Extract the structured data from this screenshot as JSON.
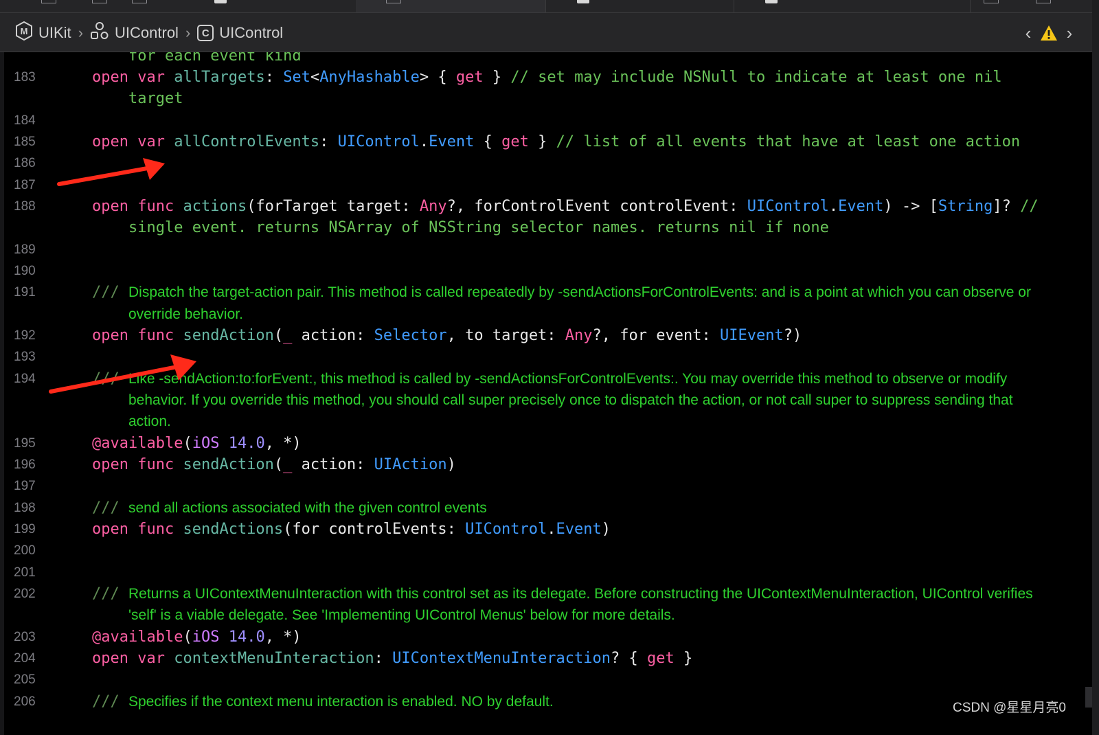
{
  "jumpbar": {
    "crumbs": [
      {
        "badge": "M",
        "label": "UIKit"
      },
      {
        "badge": "",
        "label": "UIControl"
      },
      {
        "badge": "C",
        "label": "UIControl"
      }
    ],
    "separator": "›",
    "nav_back": "‹",
    "nav_forward": "›"
  },
  "editor": {
    "lines": {
      "partial_top": "for each event kind",
      "l183_num": "183",
      "l183": {
        "open": "open",
        "var": "var",
        "name": "allTargets",
        "colon": ": ",
        "set": "Set",
        "lt": "<",
        "ah": "AnyHashable",
        "gt": ">",
        "lb": " { ",
        "get": "get",
        "rb": " } ",
        "comment": "// set may include NSNull to indicate at least one nil",
        "comment2": "target"
      },
      "l184_num": "184",
      "l185_num": "185",
      "l185": {
        "open": "open",
        "var": "var",
        "name": "allControlEvents",
        "colon": ": ",
        "t1": "UIControl",
        "dot": ".",
        "t2": "Event",
        "lb": " { ",
        "get": "get",
        "rb": " } ",
        "comment": "// list of all events that have at least one action"
      },
      "l186_num": "186",
      "l187_num": "187",
      "l188_num": "188",
      "l188": {
        "open": "open",
        "func": "func",
        "name": "actions",
        "p1": "(forTarget target: ",
        "any": "Any",
        "p2": "?, forControlEvent controlEvent: ",
        "t1": "UIControl",
        "dot": ".",
        "t2": "Event",
        "p3": ") -> [",
        "str": "String",
        "p4": "]? ",
        "comment": "//",
        "comment2": "single event. returns NSArray of NSString selector names. returns nil if none"
      },
      "l189_num": "189",
      "l190_num": "190",
      "l191_num": "191",
      "l191": {
        "mark": "///",
        "doc": "Dispatch the target-action pair. This method is called repeatedly by -sendActionsForControlEvents: and is a point at which you can observe or",
        "doc2": "override behavior."
      },
      "l192_num": "192",
      "l192": {
        "open": "open",
        "func": "func",
        "name": "sendAction",
        "p1": "(",
        "us": "_",
        "p2": " action: ",
        "sel": "Selector",
        "p3": ", to target: ",
        "any": "Any",
        "p4": "?, for event: ",
        "ev": "UIEvent",
        "p5": "?)"
      },
      "l193_num": "193",
      "l194_num": "194",
      "l194": {
        "mark": "///",
        "doc": "Like -sendAction:to:forEvent:, this method is called by -sendActionsForControlEvents:. You may override this method to observe or modify",
        "doc2": "behavior. If you override this method, you should call super precisely once to dispatch the action, or not call super to suppress sending that",
        "doc3": "action."
      },
      "l195_num": "195",
      "l195": {
        "at": "@available",
        "p1": "(",
        "ios": "iOS",
        "sp": " ",
        "ver": "14.0",
        "p2": ", *)"
      },
      "l196_num": "196",
      "l196": {
        "open": "open",
        "func": "func",
        "name": "sendAction",
        "p1": "(",
        "us": "_",
        "p2": " action: ",
        "t": "UIAction",
        "p3": ")"
      },
      "l197_num": "197",
      "l198_num": "198",
      "l198": {
        "mark": "///",
        "doc": "send all actions associated with the given control events"
      },
      "l199_num": "199",
      "l199": {
        "open": "open",
        "func": "func",
        "name": "sendActions",
        "p1": "(for controlEvents: ",
        "t1": "UIControl",
        "dot": ".",
        "t2": "Event",
        "p2": ")"
      },
      "l200_num": "200",
      "l201_num": "201",
      "l202_num": "202",
      "l202": {
        "mark": "///",
        "doc": "Returns a UIContextMenuInteraction with this control set as its delegate. Before constructing the UIContextMenuInteraction, UIControl verifies",
        "doc2": "'self' is a viable delegate. See 'Implementing UIControl Menus' below for more details."
      },
      "l203_num": "203",
      "l203": {
        "at": "@available",
        "p1": "(",
        "ios": "iOS",
        "sp": " ",
        "ver": "14.0",
        "p2": ", *)"
      },
      "l204_num": "204",
      "l204": {
        "open": "open",
        "var": "var",
        "name": "contextMenuInteraction",
        "colon": ": ",
        "t": "UIContextMenuInteraction",
        "q": "? { ",
        "get": "get",
        "rb": " }"
      },
      "l205_num": "205",
      "l206_num": "206",
      "l206": {
        "mark": "///",
        "doc": "Specifies if the context menu interaction is enabled. NO by default."
      }
    }
  },
  "watermark": "CSDN @星星月亮0",
  "colors": {
    "keyword": "#fc5fa3",
    "type": "#419cff",
    "doc_comment": "#2fd12f",
    "line_comment": "#6ac259",
    "annotation_arrow": "#ff2a1a"
  },
  "icons": [
    "module-icon",
    "folder-group-icon",
    "class-icon",
    "chevron-left-icon",
    "warning-icon",
    "chevron-right-icon"
  ]
}
